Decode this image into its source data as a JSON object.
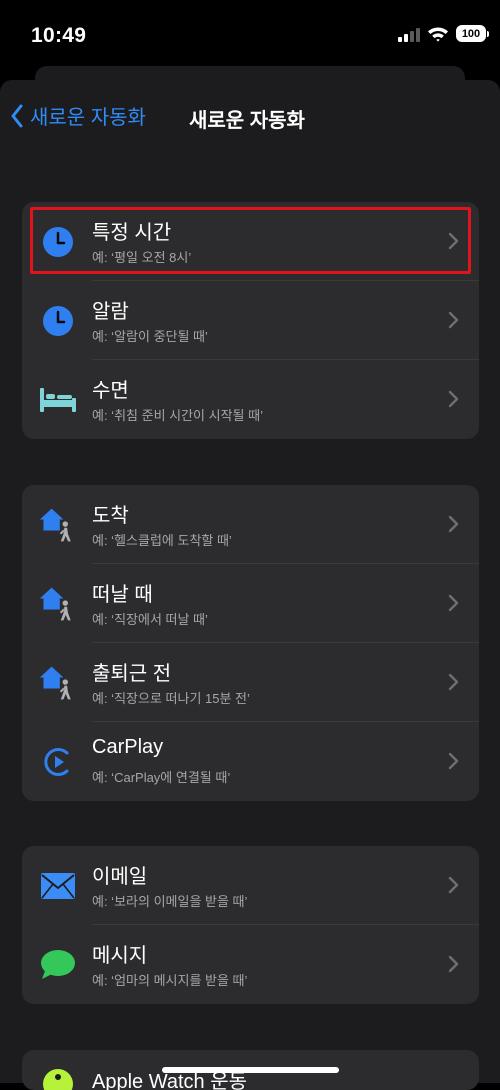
{
  "status_bar": {
    "time": "10:49",
    "battery": "100"
  },
  "nav": {
    "back_label": "새로운 자동화",
    "title": "새로운 자동화"
  },
  "groups": [
    {
      "items": [
        {
          "title": "특정 시간",
          "subtitle": "예: ‘평일 오전 8시’",
          "icon": "clock-icon"
        },
        {
          "title": "알람",
          "subtitle": "예: ‘알람이 중단될 때’",
          "icon": "clock-icon"
        },
        {
          "title": "수면",
          "subtitle": "예: ‘취침 준비 시간이 시작될 때’",
          "icon": "bed-icon"
        }
      ]
    },
    {
      "items": [
        {
          "title": "도착",
          "subtitle": "예: ‘헬스클럽에 도착할 때’",
          "icon": "home-person-icon"
        },
        {
          "title": "떠날 때",
          "subtitle": "예: ‘직장에서 떠날 때’",
          "icon": "home-person-icon"
        },
        {
          "title": "출퇴근 전",
          "subtitle": "예: ‘직장으로 떠나기 15분 전’",
          "icon": "home-person-icon"
        },
        {
          "title": "CarPlay",
          "subtitle": "예: ‘CarPlay에 연결될 때’",
          "icon": "carplay-icon"
        }
      ]
    },
    {
      "items": [
        {
          "title": "이메일",
          "subtitle": "예: ‘보라의 이메일을 받을 때’",
          "icon": "mail-icon"
        },
        {
          "title": "메시지",
          "subtitle": "예: ‘엄마의 메시지를 받을 때’",
          "icon": "message-icon"
        }
      ]
    },
    {
      "items": [
        {
          "title": "Apple Watch 운동",
          "subtitle": "",
          "icon": "watch-workout-icon"
        }
      ]
    }
  ],
  "colors": {
    "accent": "#2f8cf7",
    "background": "#000000",
    "sheet": "#1c1c1e",
    "cell": "#2c2c2e",
    "secondary_text": "#a6a6ab",
    "highlight": "#e0141c",
    "bed": "#7ed4d6",
    "message": "#34c759",
    "workout": "#b6f23a"
  }
}
